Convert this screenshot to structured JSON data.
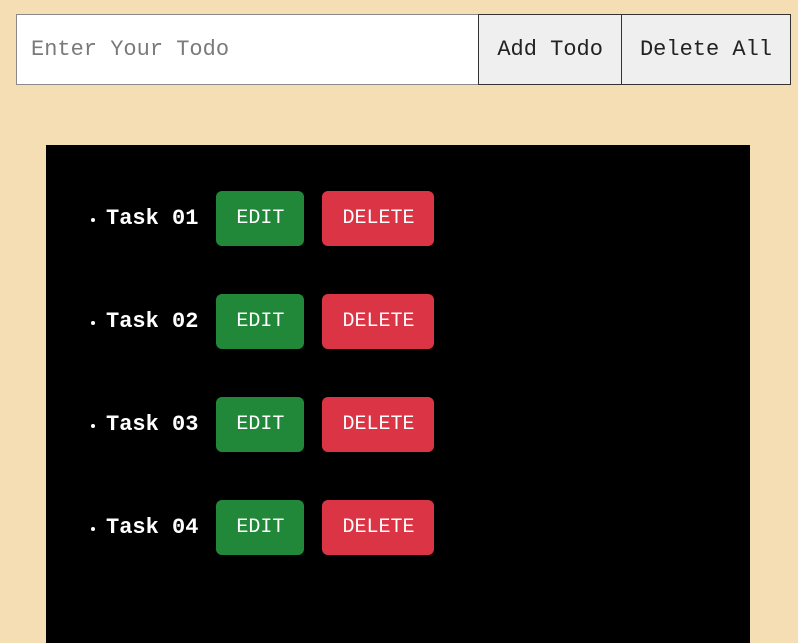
{
  "header": {
    "input_placeholder": "Enter Your Todo",
    "add_label": "Add Todo",
    "delete_all_label": "Delete All"
  },
  "buttons": {
    "edit_label": "EDIT",
    "delete_label": "DELETE"
  },
  "todos": [
    {
      "label": "Task 01"
    },
    {
      "label": "Task 02"
    },
    {
      "label": "Task 03"
    },
    {
      "label": "Task 04"
    }
  ]
}
